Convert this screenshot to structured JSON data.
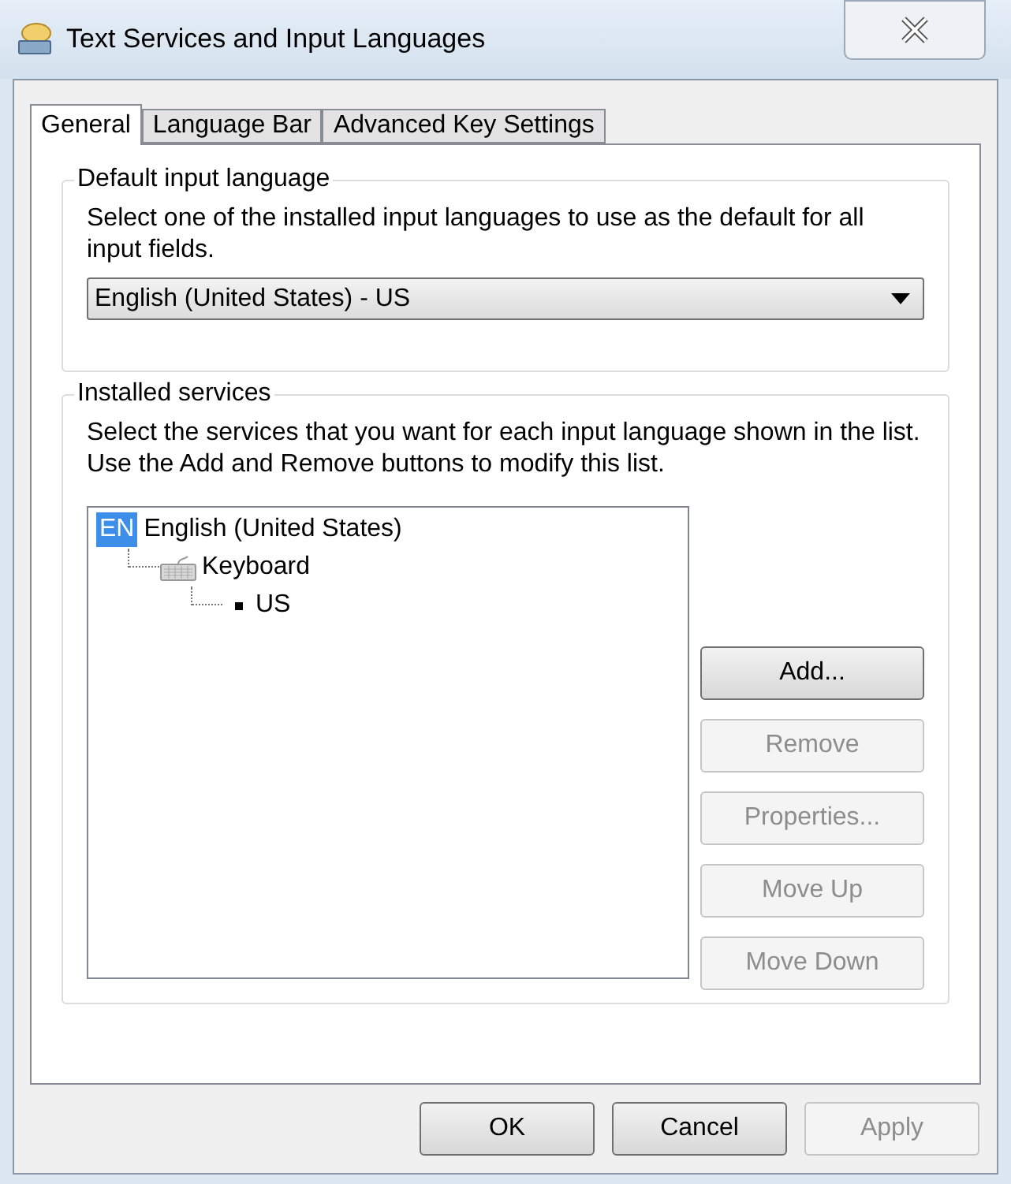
{
  "window": {
    "title": "Text Services and Input Languages"
  },
  "tabs": [
    {
      "label": "General",
      "selected": true
    },
    {
      "label": "Language Bar",
      "selected": false
    },
    {
      "label": "Advanced Key Settings",
      "selected": false
    }
  ],
  "default_input_language": {
    "heading": "Default input language",
    "description": "Select one of the installed input languages to use as the default for all input fields.",
    "dropdown": {
      "value": "English (United States) - US"
    }
  },
  "installed_services": {
    "heading": "Installed services",
    "description": "Select the services that you want for each input language shown in the list. Use the Add and Remove buttons to modify this list.",
    "tree": [
      {
        "kind": "language",
        "badge": "EN",
        "label": "English (United States)",
        "children": [
          {
            "kind": "category",
            "label": "Keyboard",
            "children": [
              {
                "kind": "layout",
                "label": "US"
              }
            ]
          }
        ]
      }
    ],
    "buttons": [
      {
        "label": "Add...",
        "disabled": false
      },
      {
        "label": "Remove",
        "disabled": true
      },
      {
        "label": "Properties...",
        "disabled": true
      },
      {
        "label": "Move Up",
        "disabled": true
      },
      {
        "label": "Move Down",
        "disabled": true
      }
    ]
  },
  "dialog_buttons": [
    {
      "label": "OK",
      "disabled": false
    },
    {
      "label": "Cancel",
      "disabled": false
    },
    {
      "label": "Apply",
      "disabled": true
    }
  ]
}
